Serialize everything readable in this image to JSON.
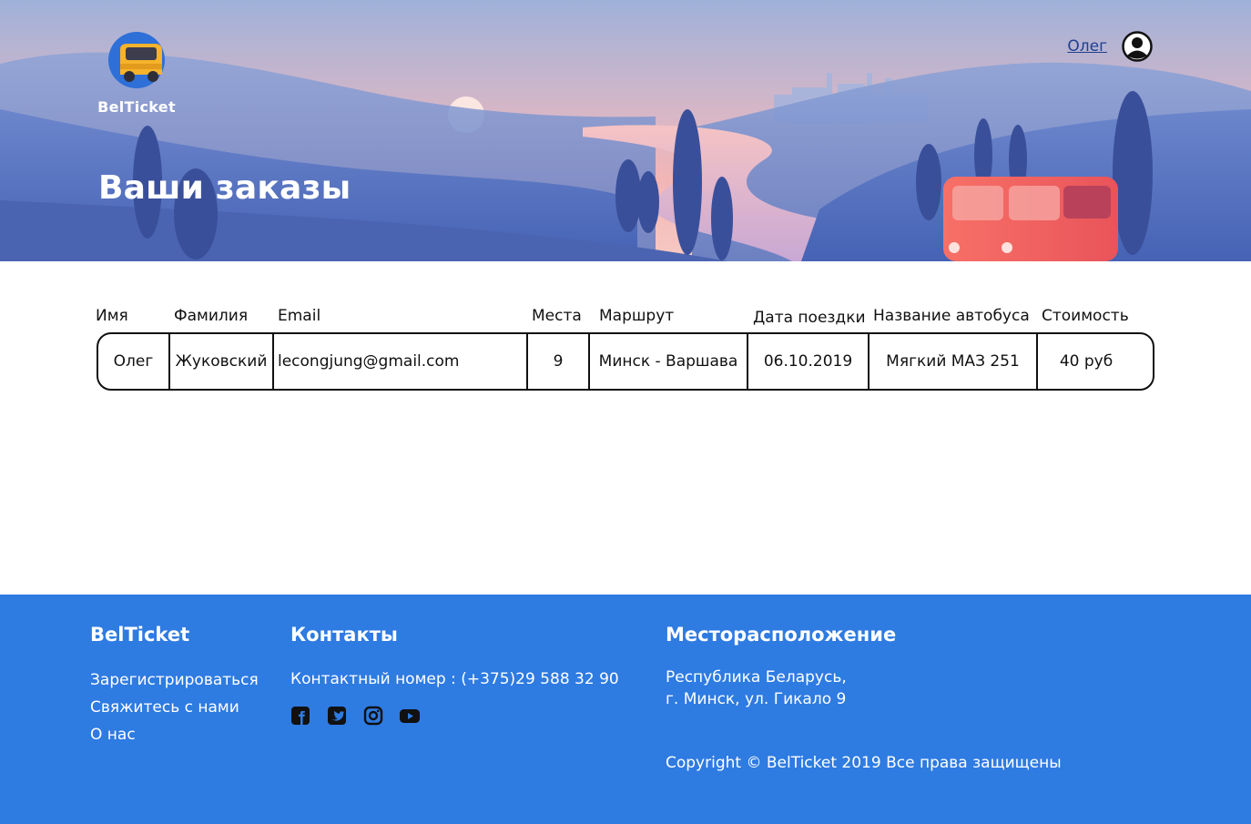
{
  "header": {
    "brand": "BelTicket",
    "user_name": "Олег",
    "page_title": "Ваши заказы"
  },
  "orders": {
    "columns": [
      "Имя",
      "Фамилия",
      "Email",
      "Места",
      "Маршрут",
      "Дата поездки",
      "Название автобуса",
      "Стоимость"
    ],
    "rows": [
      {
        "first_name": "Олег",
        "last_name": "Жуковский",
        "email": "lecongjung@gmail.com",
        "seats": "9",
        "route": "Минск - Варшава",
        "date": "06.10.2019",
        "bus_name": "Мягкий МАЗ 251",
        "price": "40 руб"
      }
    ]
  },
  "footer": {
    "brand": "BelTicket",
    "links": [
      "Зарегистрироваться",
      "Свяжитесь с нами",
      "О нас"
    ],
    "contacts_title": "Контакты",
    "contact_phone": "Контактный номер : (+375)29 588 32 90",
    "social_icons": [
      "facebook-icon",
      "twitter-icon",
      "instagram-icon",
      "youtube-icon"
    ],
    "location_title": "Месторасположение",
    "address_line1": "Республика Беларусь,",
    "address_line2": "г. Минск, ул. Гикало 9",
    "copyright": "Copyright © BelTicket 2019 Все права защищены"
  },
  "colors": {
    "footer_bg": "#2e7be2",
    "hero_sky_top": "#9fb3dc",
    "hero_sky_pink": "#f2b4b8",
    "bus_red": "#ef5b5b",
    "link_blue": "#1f3f8f"
  }
}
